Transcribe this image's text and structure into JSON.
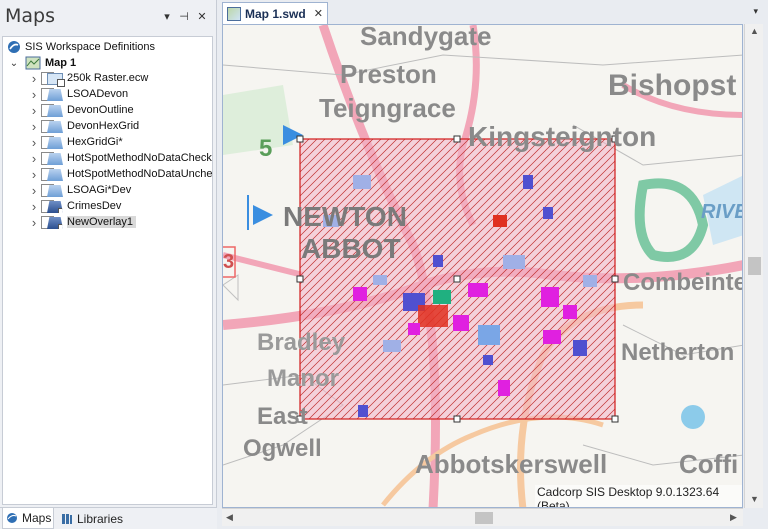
{
  "panel": {
    "title": "Maps",
    "dropdown_icon": "▾",
    "pin_icon": "⊣",
    "close_icon": "✕"
  },
  "tree": {
    "root_label": "SIS Workspace Definitions",
    "map_label": "Map 1",
    "layers": [
      {
        "label": "250k Raster.ecw",
        "kind": "raster"
      },
      {
        "label": "LSOADevon",
        "kind": "poly"
      },
      {
        "label": "DevonOutline",
        "kind": "poly"
      },
      {
        "label": "DevonHexGrid",
        "kind": "poly"
      },
      {
        "label": "HexGridGi*",
        "kind": "poly"
      },
      {
        "label": "HotSpotMethodNoDataChecke",
        "kind": "poly"
      },
      {
        "label": "HotSpotMethodNoDataUnchec",
        "kind": "poly"
      },
      {
        "label": "LSOAGi*Dev",
        "kind": "poly"
      },
      {
        "label": "CrimesDev",
        "kind": "ovl"
      },
      {
        "label": "NewOverlay1",
        "kind": "ovl",
        "selected": true
      }
    ]
  },
  "bottom_tabs": {
    "maps": "Maps",
    "libraries": "Libraries"
  },
  "document": {
    "tab_label": "Map 1.swd",
    "tab_close": "✕",
    "dropdown": "▾"
  },
  "map": {
    "places": {
      "sandygate": "Sandygate",
      "preston": "Preston",
      "bishopsteignton": "Bishopst",
      "teigngrace": "Teigngrace",
      "kingsteignton": "Kingsteignton",
      "newton": "NEWTON",
      "abbot": "ABBOT",
      "combeinteignhead": "Combeinte",
      "netherton": "Netherton",
      "bradley": "Bradley",
      "manor": "Manor",
      "east": "East",
      "ogwell": "Ogwell",
      "abbotskerswell": "Abbotskerswell",
      "coffinswell": "Coffi",
      "river": "RIVE",
      "road_number": "5",
      "road_number2": "3"
    },
    "status": "Cadcorp SIS Desktop 9.0.1323.64 (Beta)"
  },
  "colors": {
    "selection": "#d11a1a",
    "hatch": "#c03030",
    "road_pink": "#f2a6b8",
    "hotspot_magenta": "#e020e0",
    "hotspot_blue": "#5050d0",
    "hotspot_red": "#e03020",
    "hotspot_green": "#20b080"
  }
}
